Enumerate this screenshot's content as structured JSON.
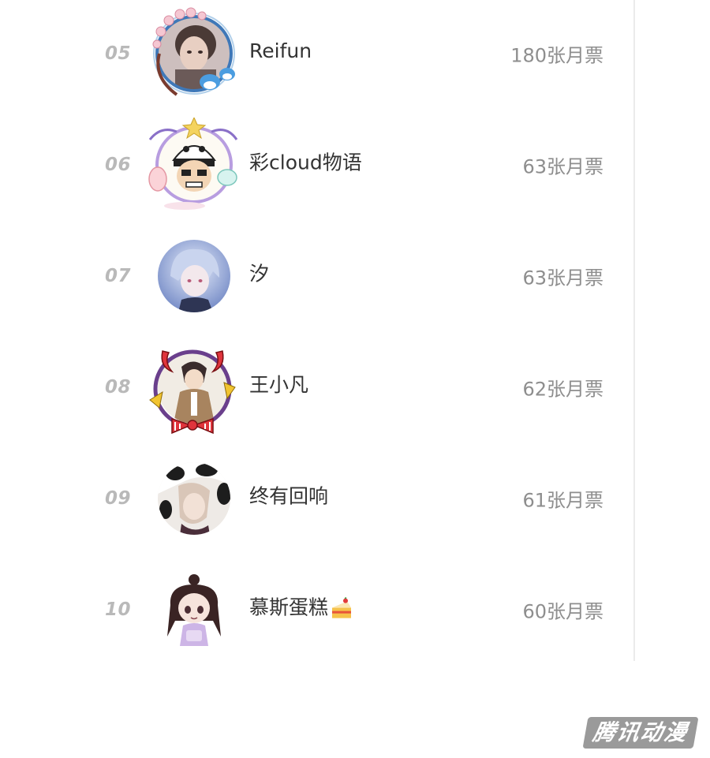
{
  "ranking": {
    "rows": [
      {
        "rank": "05",
        "name": "Reifun",
        "votes": "180张月票",
        "avatar_desc": "photo-avatar",
        "frame": "cherry-blossom-frame"
      },
      {
        "rank": "06",
        "name": "彩cloud物语",
        "votes": "63张月票",
        "avatar_desc": "cartoon-panda-hat-avatar",
        "frame": "star-unicorn-frame"
      },
      {
        "rank": "07",
        "name": "汐",
        "votes": "63张月票",
        "avatar_desc": "anime-boy-avatar",
        "frame": "none"
      },
      {
        "rank": "08",
        "name": "王小凡",
        "votes": "62张月票",
        "avatar_desc": "anime-character-avatar",
        "frame": "devil-horns-bow-frame"
      },
      {
        "rank": "09",
        "name": "终有回响",
        "votes": "61张月票",
        "avatar_desc": "cow-print-anime-avatar",
        "frame": "none"
      },
      {
        "rank": "10",
        "name": "慕斯蛋糕",
        "votes": "60张月票",
        "avatar_desc": "chibi-girl-avatar",
        "frame": "none",
        "name_emoji": "cake-icon"
      }
    ]
  },
  "watermark": {
    "text": "腾讯动漫"
  },
  "colors": {
    "rank": "#b9b9b9",
    "name": "#333333",
    "votes": "#8e8e8e",
    "divider": "#ebebeb"
  }
}
